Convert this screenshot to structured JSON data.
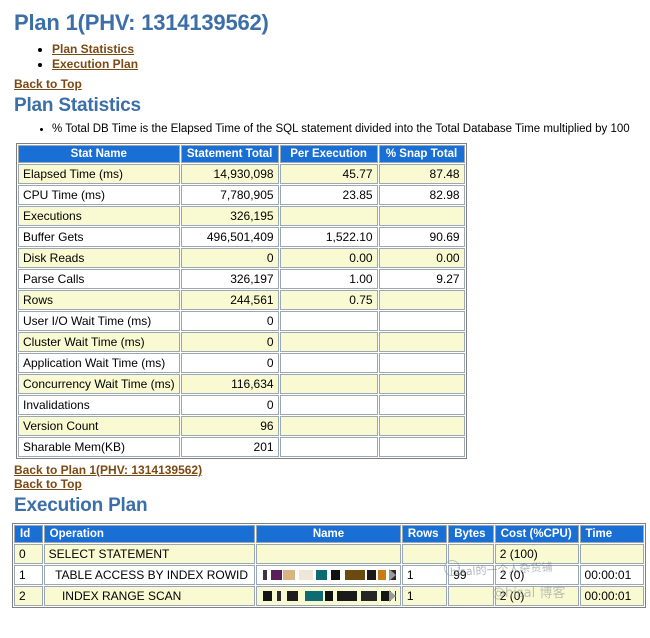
{
  "page": {
    "title": "Plan 1(PHV: 1314139562)"
  },
  "toc": {
    "items": [
      {
        "label": "Plan Statistics"
      },
      {
        "label": "Execution Plan"
      }
    ],
    "back_to_top": "Back to Top"
  },
  "plan_statistics": {
    "heading": "Plan Statistics",
    "note": "% Total DB Time is the Elapsed Time of the SQL statement divided into the Total Database Time multiplied by 100",
    "columns": [
      "Stat Name",
      "Statement Total",
      "Per Execution",
      "% Snap Total"
    ],
    "rows": [
      {
        "stat": "Elapsed Time (ms)",
        "total": "14,930,098",
        "per_exec": "45.77",
        "snap_pct": "87.48"
      },
      {
        "stat": "CPU Time (ms)",
        "total": "7,780,905",
        "per_exec": "23.85",
        "snap_pct": "82.98"
      },
      {
        "stat": "Executions",
        "total": "326,195",
        "per_exec": "",
        "snap_pct": ""
      },
      {
        "stat": "Buffer Gets",
        "total": "496,501,409",
        "per_exec": "1,522.10",
        "snap_pct": "90.69"
      },
      {
        "stat": "Disk Reads",
        "total": "0",
        "per_exec": "0.00",
        "snap_pct": "0.00"
      },
      {
        "stat": "Parse Calls",
        "total": "326,197",
        "per_exec": "1.00",
        "snap_pct": "9.27"
      },
      {
        "stat": "Rows",
        "total": "244,561",
        "per_exec": "0.75",
        "snap_pct": ""
      },
      {
        "stat": "User I/O Wait Time (ms)",
        "total": "0",
        "per_exec": "",
        "snap_pct": ""
      },
      {
        "stat": "Cluster Wait Time (ms)",
        "total": "0",
        "per_exec": "",
        "snap_pct": ""
      },
      {
        "stat": "Application Wait Time (ms)",
        "total": "0",
        "per_exec": "",
        "snap_pct": ""
      },
      {
        "stat": "Concurrency Wait Time (ms)",
        "total": "116,634",
        "per_exec": "",
        "snap_pct": ""
      },
      {
        "stat": "Invalidations",
        "total": "0",
        "per_exec": "",
        "snap_pct": ""
      },
      {
        "stat": "Version Count",
        "total": "96",
        "per_exec": "",
        "snap_pct": ""
      },
      {
        "stat": "Sharable Mem(KB)",
        "total": "201",
        "per_exec": "",
        "snap_pct": ""
      }
    ],
    "footer_links": {
      "back_to_plan": "Back to Plan 1(PHV: 1314139562)",
      "back_to_top": "Back to Top"
    }
  },
  "execution_plan": {
    "heading": "Execution Plan",
    "columns": [
      "Id",
      "Operation",
      "Name",
      "Rows",
      "Bytes",
      "Cost (%CPU)",
      "Time"
    ],
    "rows": [
      {
        "id": "0",
        "operation": "SELECT STATEMENT",
        "name": "",
        "rows": "",
        "bytes": "",
        "cost": "2 (100)",
        "time": ""
      },
      {
        "id": "1",
        "operation": "  TABLE ACCESS BY INDEX ROWID",
        "name": "[redacted]",
        "rows": "1",
        "bytes": "99",
        "cost": "2 (0)",
        "time": "00:00:01"
      },
      {
        "id": "2",
        "operation": "    INDEX RANGE SCAN",
        "name": "[redacted]",
        "rows": "1",
        "bytes": "",
        "cost": "2 (0)",
        "time": "00:00:01"
      }
    ]
  },
  "watermark": {
    "line1": "hisal的一个人杂货铺",
    "line2": "@hisal 博客"
  },
  "colors": {
    "heading": "#3C6EA8",
    "table_header_bg": "#1A6FD4",
    "row_alt_bg": "#FAFAD2",
    "link": "#7B4A12"
  }
}
